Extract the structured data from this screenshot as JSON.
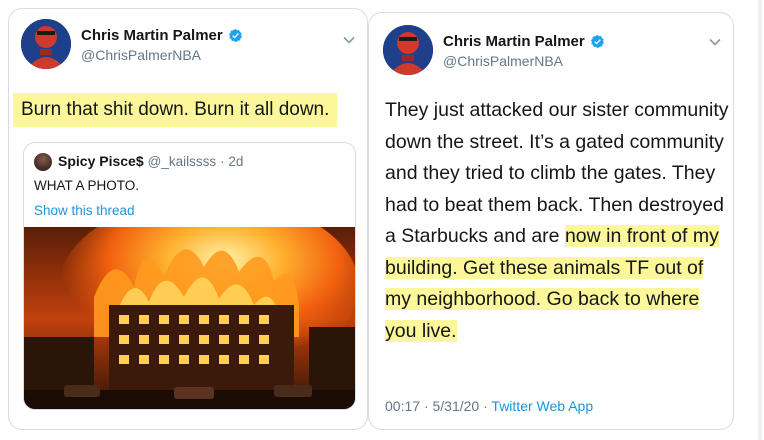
{
  "left_tweet": {
    "author": {
      "name": "Chris Martin Palmer",
      "handle": "@ChrisPalmerNBA",
      "verified": true
    },
    "text": "Burn that shit down. Burn it all down.",
    "quoted_tweet": {
      "author_name": "Spicy Pisce$",
      "author_handle": "@_kailssss",
      "age": "· 2d",
      "text": "WHAT A PHOTO.",
      "show_thread_label": "Show this thread",
      "media": "photo of burning building"
    }
  },
  "right_tweet": {
    "author": {
      "name": "Chris Martin Palmer",
      "handle": "@ChrisPalmerNBA",
      "verified": true
    },
    "text_plain": "They just attacked our sister community down the street. It’s a gated community and they tried to climb the gates. They had to beat them back. Then destroyed a Starbucks and are ",
    "text_highlighted": "now in front of my building. Get these animals TF out of my neighborhood. Go back to where you live.",
    "time": "00:17",
    "separator": "·",
    "date": "5/31/20",
    "source": "Twitter Web App"
  },
  "colors": {
    "highlight": "#fbf79a",
    "link": "#1b95e0",
    "muted": "#657786",
    "verified": "#1da1f2"
  },
  "icons": [
    "verified-badge-icon",
    "chevron-down-icon"
  ]
}
